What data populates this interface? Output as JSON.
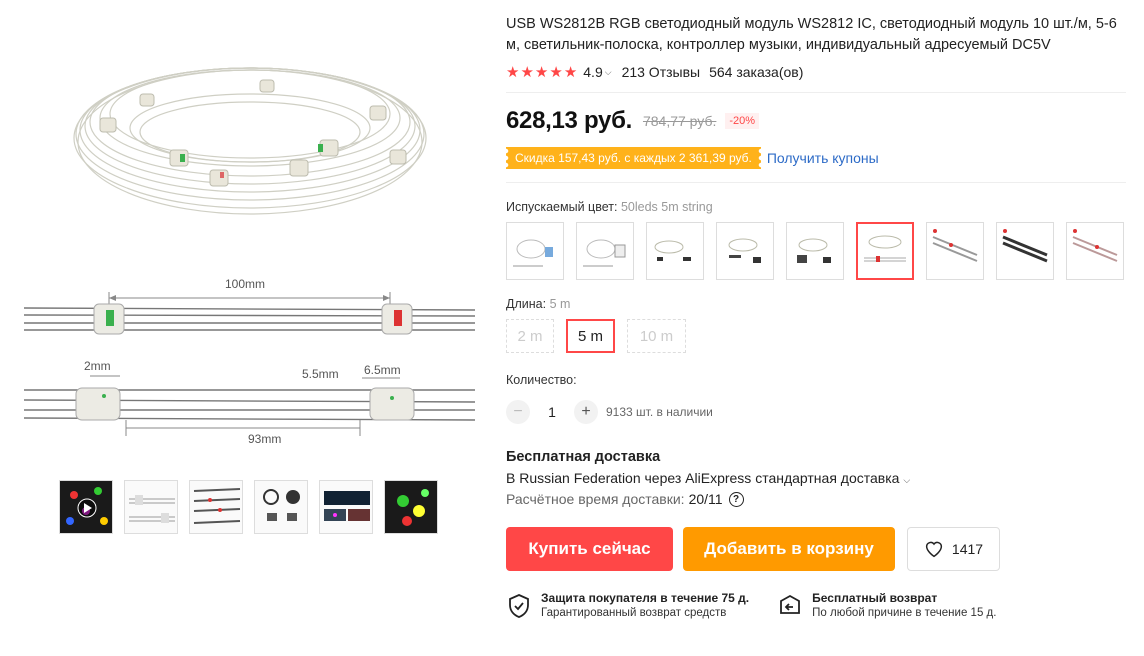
{
  "product": {
    "title": "USB WS2812B RGB светодиодный модуль WS2812 IC, светодиодный модуль 10 шт./м, 5-6 м, светильник-полоска, контроллер музыки, индивидуальный адресуемый DC5V",
    "rating": "4.9",
    "reviews": "213 Отзывы",
    "orders": "564 заказа(ов)"
  },
  "gallery": {
    "dim_100": "100mm",
    "dim_2": "2mm",
    "dim_55": "5.5mm",
    "dim_65": "6.5mm",
    "dim_93": "93mm",
    "thumb_icons": [
      "rgb-lights-video-thumb",
      "strip-diagram-thumb",
      "strip-rows-thumb",
      "module-chips-thumb",
      "application-scenes-thumb",
      "colored-lights-thumb"
    ]
  },
  "price": {
    "current": "628,13 руб.",
    "old": "784,77 руб.",
    "discount": "-20%"
  },
  "coupon": {
    "text": "Скидка 157,43 руб. с каждых 2 361,39 руб.",
    "link": "Получить купоны"
  },
  "color": {
    "label": "Испускаемый цвет:",
    "value": "50leds 5m string",
    "selected_index": 5
  },
  "length": {
    "label": "Длина:",
    "value": "5 m",
    "options": [
      "2 m",
      "5 m",
      "10 m"
    ]
  },
  "quantity": {
    "label": "Количество:",
    "minus": "−",
    "plus": "+",
    "value": "1",
    "stock": "9133 шт. в наличии"
  },
  "shipping": {
    "title": "Бесплатная доставка",
    "desc": "В Russian Federation через AliExpress стандартная доставка",
    "time_label": "Расчётное время доставки:",
    "time_value": "20/11"
  },
  "actions": {
    "buy": "Купить сейчас",
    "cart": "Добавить в корзину",
    "wishlist_count": "1417"
  },
  "guarantees": [
    {
      "title": "Защита покупателя в течение 75 д.",
      "sub": "Гарантированный возврат средств"
    },
    {
      "title": "Бесплатный возврат",
      "sub": "По любой причине в течение 15 д."
    }
  ],
  "colors": {
    "accent": "#ff4747",
    "orange": "#ff9a00",
    "coupon": "#ffb21a",
    "link": "#2d6bc7"
  }
}
